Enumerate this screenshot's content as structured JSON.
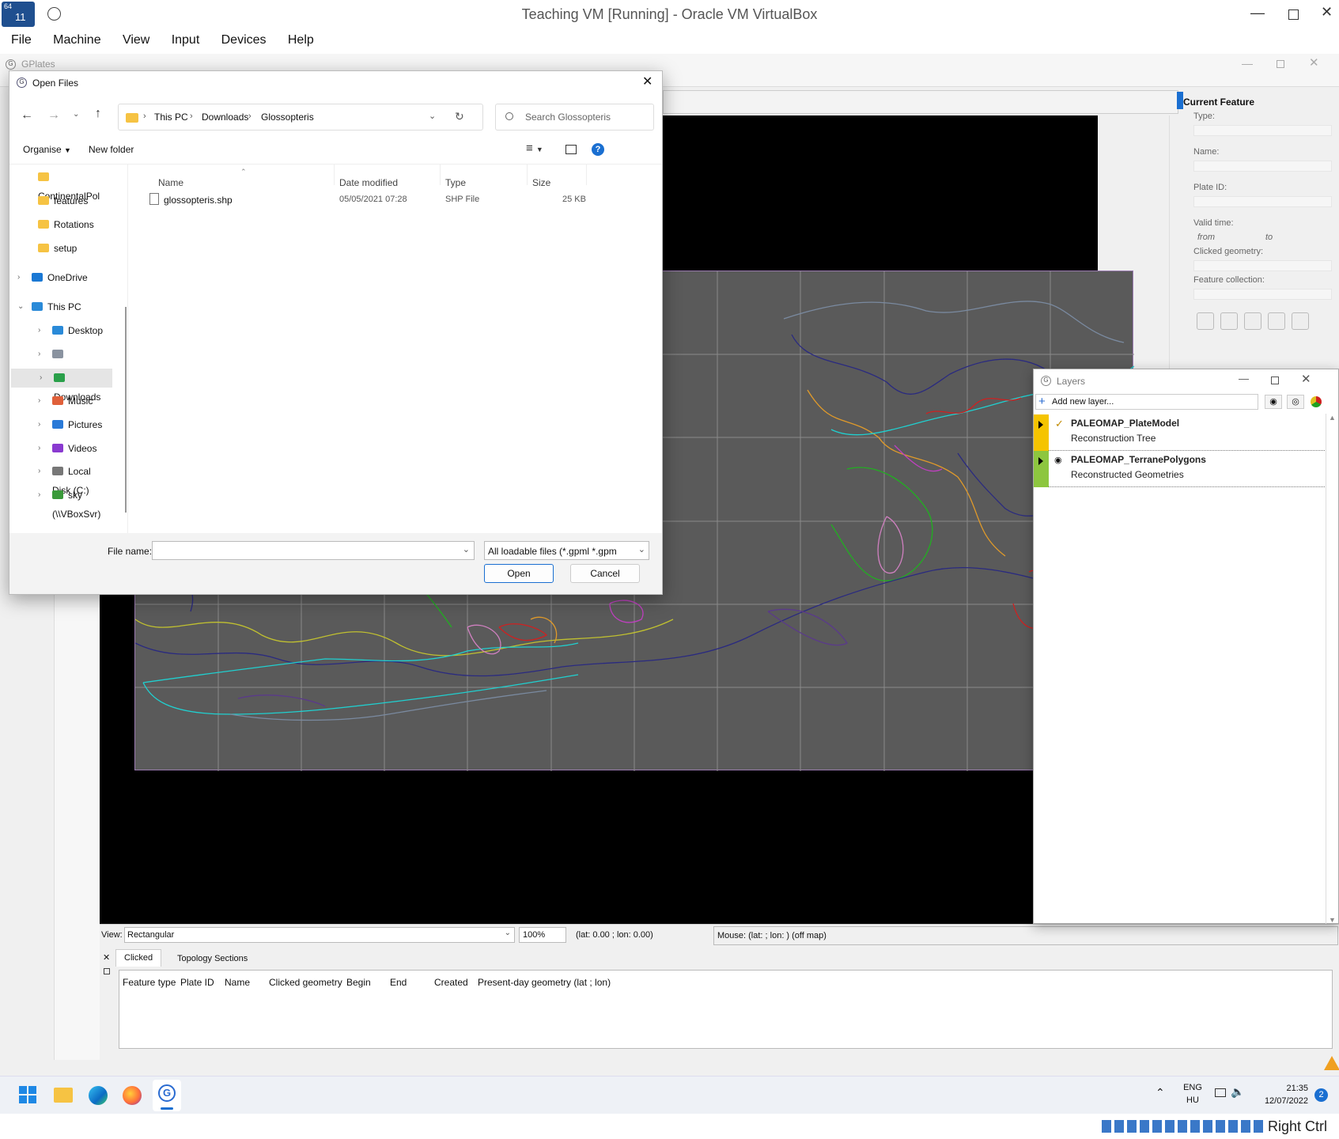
{
  "host": {
    "title": "Teaching VM [Running] - Oracle VM VirtualBox",
    "menu": [
      "File",
      "Machine",
      "View",
      "Input",
      "Devices",
      "Help"
    ],
    "badge": "64\n11",
    "host_key": "Right Ctrl"
  },
  "gplates": {
    "title": "GPlates"
  },
  "current_feature": {
    "heading": "Current Feature",
    "type_label": "Type:",
    "name_label": "Name:",
    "plate_id_label": "Plate ID:",
    "valid_time_label": "Valid time:",
    "from_label": "from",
    "to_label": "to",
    "clicked_geometry_label": "Clicked geometry:",
    "feature_collection_label": "Feature collection:"
  },
  "status": {
    "view_label": "View:",
    "view_value": "Rectangular",
    "zoom": "100%",
    "camera": "(lat: 0.00 ; lon: 0.00)",
    "mouse": "Mouse: (lat:  ; lon: ) (off map)"
  },
  "bottom": {
    "tabs": [
      "Clicked",
      "Topology Sections"
    ],
    "columns": [
      "Feature type",
      "Plate ID",
      "Name",
      "Clicked geometry",
      "Begin",
      "End",
      "Created",
      "Present-day geometry (lat ; lon)"
    ]
  },
  "dialog": {
    "title": "Open Files",
    "breadcrumb": [
      "This PC",
      "Downloads",
      "Glossopteris"
    ],
    "search_placeholder": "Search Glossopteris",
    "organise": "Organise",
    "new_folder": "New folder",
    "nav": [
      {
        "label": "ContinentalPol",
        "icon": "folder-icon"
      },
      {
        "label": "features",
        "icon": "folder-icon"
      },
      {
        "label": "Rotations",
        "icon": "folder-icon"
      },
      {
        "label": "setup",
        "icon": "folder-icon"
      },
      {
        "label": "OneDrive",
        "icon": "cloud-icon"
      },
      {
        "label": "This PC",
        "icon": "computer-icon"
      },
      {
        "label": "Desktop",
        "icon": "desktop-icon"
      },
      {
        "label": "Documents",
        "icon": "documents-icon"
      },
      {
        "label": "Downloads",
        "icon": "download-icon"
      },
      {
        "label": "Music",
        "icon": "music-icon"
      },
      {
        "label": "Pictures",
        "icon": "pictures-icon"
      },
      {
        "label": "Videos",
        "icon": "videos-icon"
      },
      {
        "label": "Local Disk (C:)",
        "icon": "disk-icon"
      },
      {
        "label": "sky (\\\\VBoxSvr)",
        "icon": "network-drive-icon"
      }
    ],
    "columns": [
      "Name",
      "Date modified",
      "Type",
      "Size"
    ],
    "files": [
      {
        "name": "glossopteris.shp",
        "date": "05/05/2021 07:28",
        "type": "SHP File",
        "size": "25 KB"
      }
    ],
    "file_name_label": "File name:",
    "file_name_value": "",
    "filter": "All loadable files (*.gpml *.gpm",
    "open": "Open",
    "cancel": "Cancel"
  },
  "layers": {
    "title": "Layers",
    "add_new": "Add new layer...",
    "items": [
      {
        "name": "PALEOMAP_PlateModel",
        "type": "Reconstruction Tree",
        "color": "#f5c400"
      },
      {
        "name": "PALEOMAP_TerranePolygons",
        "type": "Reconstructed Geometries",
        "color": "#8dc63f"
      }
    ]
  },
  "tray": {
    "lang": "ENG",
    "layout": "HU",
    "time": "21:35",
    "date": "12/07/2022",
    "notifications": "2"
  }
}
